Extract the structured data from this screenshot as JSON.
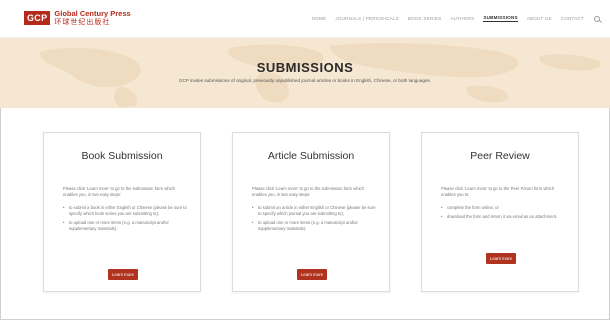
{
  "header": {
    "logo_mark": "GCP",
    "logo_name_en": "Global Century Press",
    "logo_name_zh": "环球世纪出版社",
    "nav": [
      "HOME",
      "JOURNALS | PERIODICALS",
      "BOOK SERIES",
      "AUTHORS",
      "SUBMISSIONS",
      "ABOUT US",
      "CONTACT"
    ],
    "active_nav": "SUBMISSIONS"
  },
  "hero": {
    "title": "SUBMISSIONS",
    "subtitle": "GCP invites submissions of original, previously unpublished journal articles or books in English, Chinese, or both languages."
  },
  "cards": [
    {
      "title": "Book Submission",
      "desc": "Please click 'Learn more' to go to the submission form which enables you, in two easy steps:",
      "bullets": [
        "to submit a book in either English or Chinese (please be sure to specify which book series you are submitting to);",
        "to upload one or more items (e.g. a manuscript and/or supplementary materials)."
      ],
      "button": "Learn more"
    },
    {
      "title": "Article Submission",
      "desc": "Please click 'Learn more' to go to the submission form which enables you, in two easy steps:",
      "bullets": [
        "to submit an article in either English or Chinese (please be sure to specify which journal you are submitting to);",
        "to upload one or more items (e.g. a manuscript and/or supplementary materials)."
      ],
      "button": "Learn more"
    },
    {
      "title": "Peer Review",
      "desc": "Please click 'Learn more' to go to the Peer Forum form which enables you to:",
      "bullets": [
        "complete the form online; or",
        "download the form and return it via email as an attachment."
      ],
      "button": "Learn more"
    }
  ],
  "colors": {
    "brand": "#b52b1b",
    "button": "#b0331f",
    "hero_bg": "#f6e7d2"
  }
}
